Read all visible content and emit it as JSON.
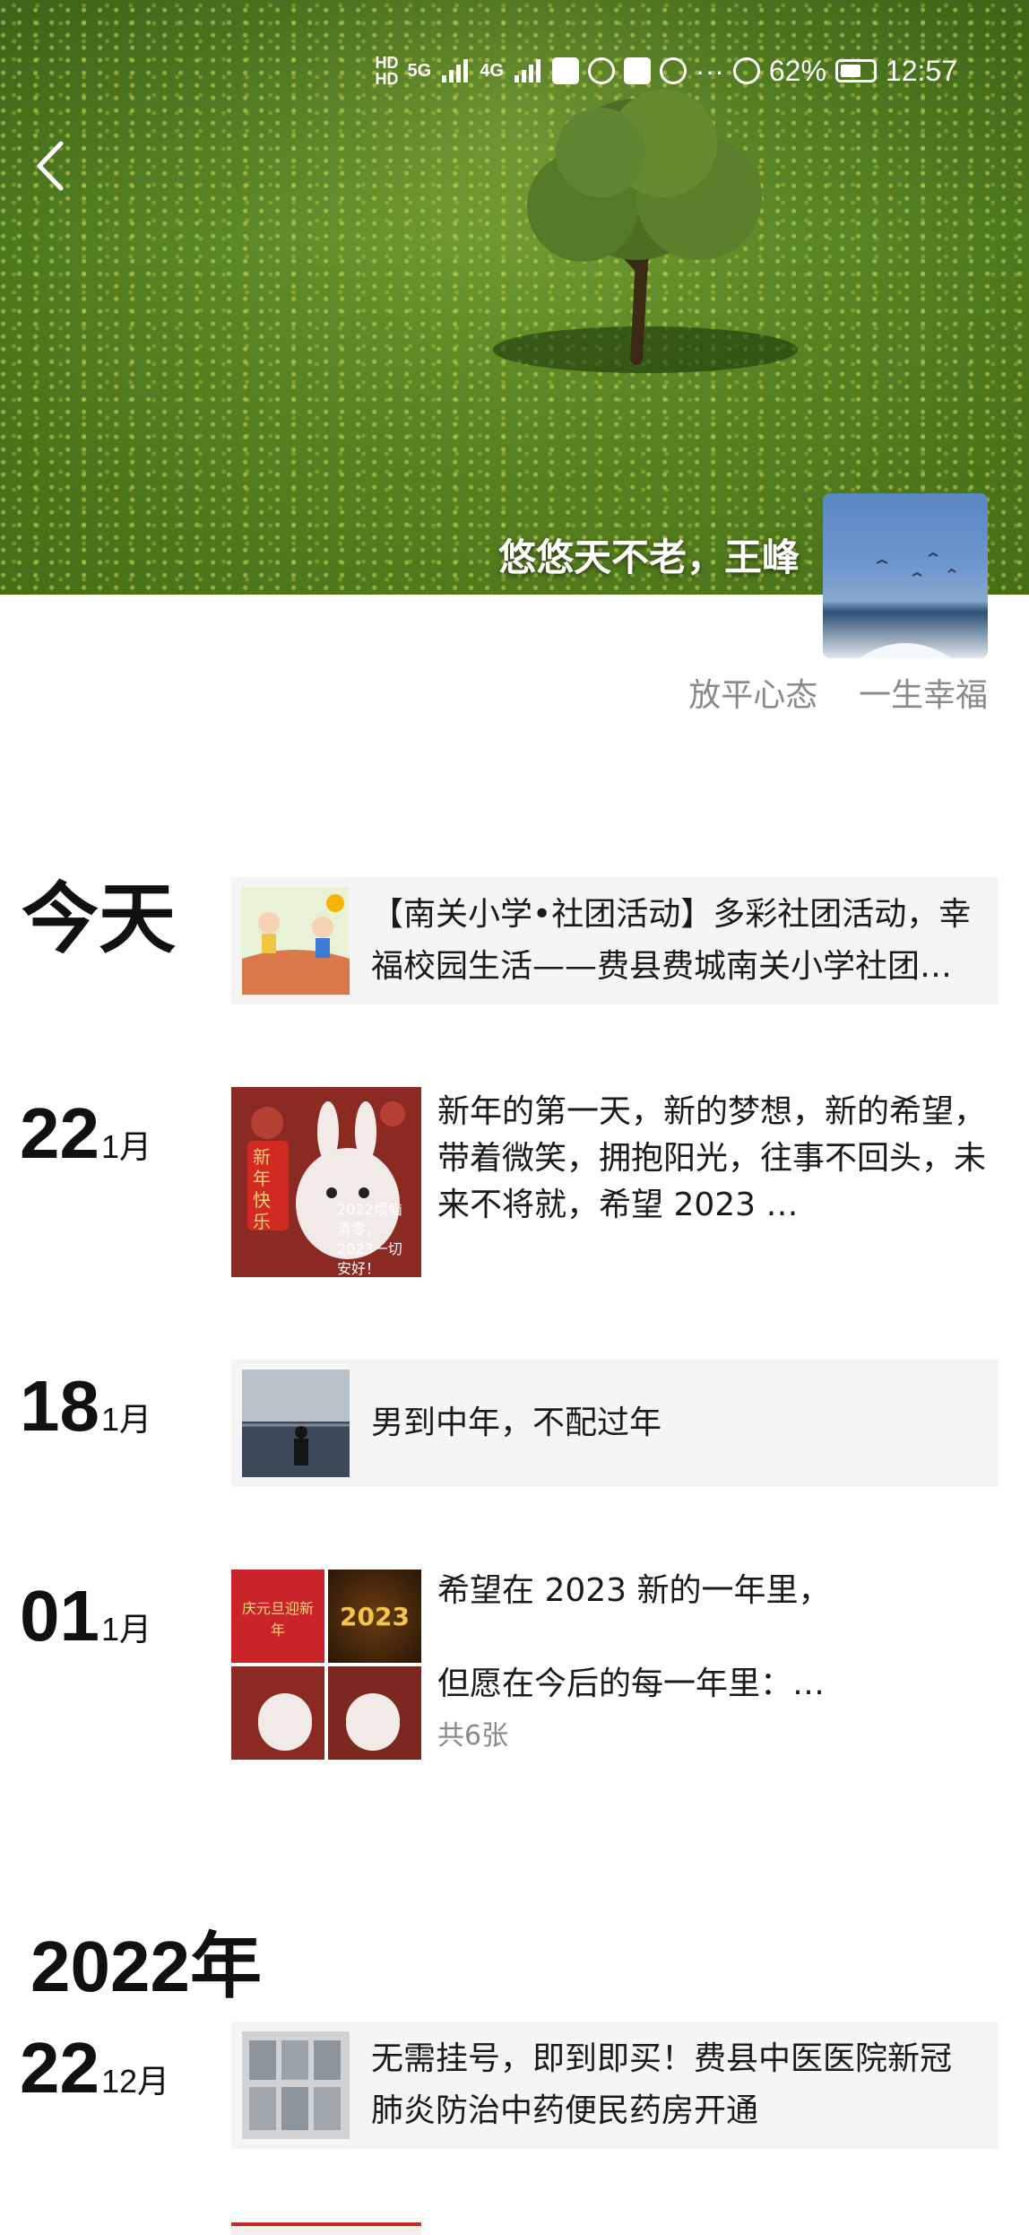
{
  "status_bar": {
    "battery": "62%",
    "time": "12:57",
    "net1": "5G",
    "net2": "4G"
  },
  "cover": {
    "title": "悠悠天不老，王峰"
  },
  "profile": {
    "signature": "放平心态    一生幸福"
  },
  "posts": [
    {
      "date_label": "今天",
      "type": "share",
      "text": "【南关小学•社团活动】多彩社团活动，幸福校园生活——费县费城南关小学社团活动"
    },
    {
      "day": "22",
      "month": "1月",
      "type": "photo",
      "text": "新年的第一天，新的梦想，新的希望，带着微笑，拥抱阳光，往事不回头，未来不将就，希望 2023 …",
      "photo_caption_1": "新年快乐",
      "photo_caption_2": "2022烦恼清零，2023一切安好！"
    },
    {
      "day": "18",
      "month": "1月",
      "type": "share",
      "text": "男到中年，不配过年"
    },
    {
      "day": "01",
      "month": "1月",
      "type": "multi-photo",
      "text_line1": "希望在 2023 新的一年里，",
      "text_line2": "但愿在今后的每一年里：…",
      "count": "共6张",
      "photo_texts": [
        "庆元旦迎新年",
        "2023"
      ]
    },
    {
      "year": "2022年"
    },
    {
      "day": "22",
      "month": "12月",
      "type": "share",
      "text": "无需挂号，即到即买！费县中医医院新冠肺炎防治中药便民药房开通"
    }
  ],
  "colors": {
    "accent_text": "#111111",
    "card_bg": "#f5f5f5",
    "muted": "#8a8a8a"
  }
}
